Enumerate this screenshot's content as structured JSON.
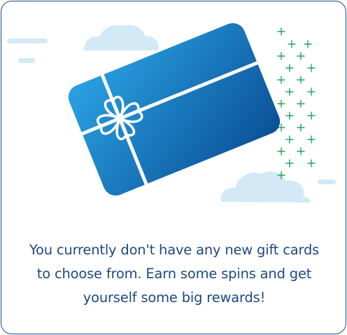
{
  "empty_state": {
    "illustration_icon": "gift-card-icon",
    "message": "You currently don't have any new gift cards to choose from. Earn some spins and get yourself some big rewards!"
  },
  "colors": {
    "border": "#1b4f8a",
    "text": "#1e4a80",
    "card_light": "#2aa3e4",
    "card_dark": "#0b4f96",
    "cloud": "#d3e9f6",
    "sparkle": "#1aa85a"
  }
}
